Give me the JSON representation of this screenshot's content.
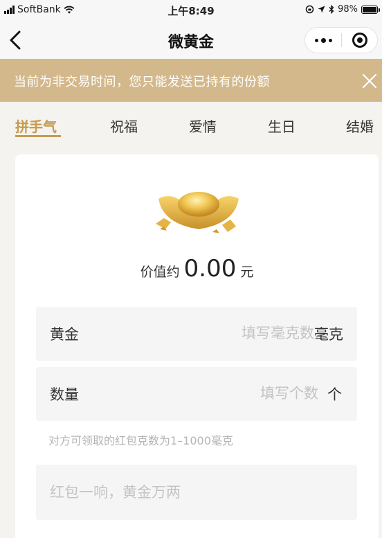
{
  "status_bar": {
    "carrier": "SoftBank",
    "time": "上午8:49",
    "battery": "98%",
    "battery_level": 0.98
  },
  "nav": {
    "title": "微黄金",
    "back_icon": "chevron-left-icon",
    "more_icon": "more-dots-icon",
    "close_icon": "target-close-icon"
  },
  "notice": {
    "text": "当前为非交易时间，您只能发送已持有的份额",
    "close_icon": "close-icon"
  },
  "tabs": [
    {
      "label": "拼手气",
      "active": true
    },
    {
      "label": "祝福",
      "active": false
    },
    {
      "label": "爱情",
      "active": false
    },
    {
      "label": "生日",
      "active": false
    },
    {
      "label": "结婚",
      "active": false
    }
  ],
  "card": {
    "value_prefix": "价值约",
    "value": "0.00",
    "value_unit": "元",
    "gold_field": {
      "label": "黄金",
      "placeholder": "填写毫克数",
      "unit": "毫克"
    },
    "quantity_field": {
      "label": "数量",
      "placeholder": "填写个数",
      "unit": "个"
    },
    "hint": "对方可领取的红包克数为1–1000毫克",
    "greeting_placeholder": "红包一响，黄金万两"
  },
  "colors": {
    "accent_gold": "#c69b4e",
    "notice_bg": "#d3b88b",
    "page_bg": "#f4f3ef"
  }
}
